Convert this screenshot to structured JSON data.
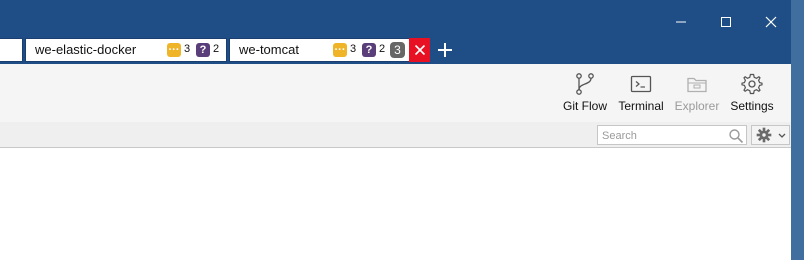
{
  "window": {
    "controls": {
      "minimize": "minimize",
      "maximize": "maximize",
      "close": "close"
    }
  },
  "tabs": [
    {
      "title": ""
    },
    {
      "title": "we-elastic-docker",
      "pending": "3",
      "untracked": "2"
    },
    {
      "title": "we-tomcat",
      "pending": "3",
      "untracked": "2",
      "stashes": "3"
    }
  ],
  "toolbar": {
    "git_flow": "Git Flow",
    "terminal": "Terminal",
    "explorer": "Explorer",
    "settings": "Settings"
  },
  "search": {
    "placeholder": "Search"
  },
  "colors": {
    "titlebar": "#1f4e86",
    "pending_badge": "#f0b429",
    "untracked_badge": "#5a3e7a",
    "stash_badge": "#666666",
    "tab_close": "#e81123"
  },
  "icons": {
    "pending": "ellipsis-icon",
    "untracked": "question-icon",
    "git_flow": "git-flow-icon",
    "terminal": "terminal-icon",
    "explorer": "folder-icon",
    "settings": "gear-icon",
    "search": "search-icon"
  }
}
